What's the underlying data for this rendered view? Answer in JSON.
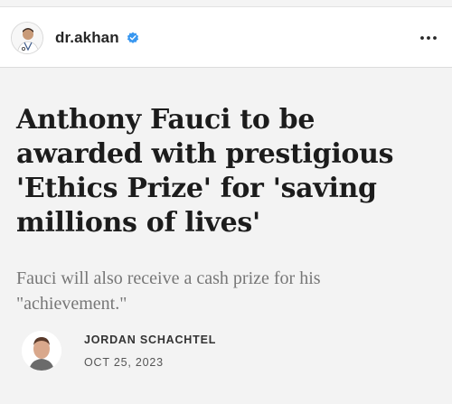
{
  "post": {
    "username": "dr.akhan",
    "verified": true,
    "avatar_icon": "doctor-avatar",
    "more_icon": "more-horizontal-icon"
  },
  "article": {
    "headline": "Anthony Fauci to be awarded with prestigious 'Ethics Prize' for 'saving millions of lives'",
    "subtitle": "Fauci will also receive a cash prize for his \"achievement.\"",
    "author": {
      "name": "JORDAN SCHACHTEL",
      "date": "OCT 25, 2023",
      "avatar_icon": "author-avatar"
    }
  },
  "colors": {
    "verified_badge": "#3897f0",
    "headline": "#1c1c1c",
    "subtitle": "#777777",
    "background": "#f3f3f3"
  }
}
